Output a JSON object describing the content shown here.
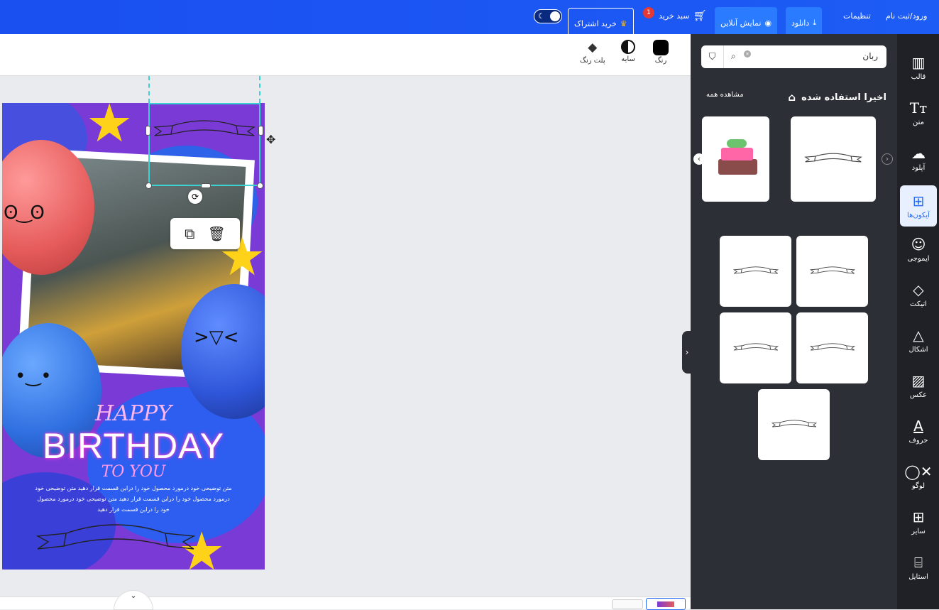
{
  "header": {
    "login": "ورود/ثبت نام",
    "settings": "تنظیمات",
    "download": "دانلود",
    "online_view": "نمایش آنلاین",
    "cart": "سبد خرید",
    "cart_count": "1",
    "subscribe": "خرید اشتراک"
  },
  "toolbar": {
    "color": "رنگ",
    "shadow": "سایه",
    "palette": "پلت رنگ"
  },
  "design": {
    "happy": "HAPPY",
    "birthday": "BIRTHDAY",
    "to_you": "TO YOU",
    "desc_lines": [
      "متن توضیحی خود درمورد محصول خود را دراین قسمت قرار دهید متن توضیحی خود",
      "درمورد محصول خود را دراین قسمت قرار دهید متن توضیحی خود درمورد محصول",
      "خود را دراین قسمت قرار دهید"
    ]
  },
  "panel": {
    "search_value": "ربان",
    "recent_title": "اخیرا استفاده شده",
    "view_all": "مشاهده همه"
  },
  "sidebar": {
    "items": [
      {
        "label": "قالب",
        "icon": "template-icon"
      },
      {
        "label": "متن",
        "icon": "text-icon"
      },
      {
        "label": "آپلود",
        "icon": "upload-icon"
      },
      {
        "label": "آیکون‌ها",
        "icon": "icons-icon"
      },
      {
        "label": "ایموجی",
        "icon": "emoji-icon"
      },
      {
        "label": "اتیکت",
        "icon": "tag-icon"
      },
      {
        "label": "اشکال",
        "icon": "shapes-icon"
      },
      {
        "label": "عکس",
        "icon": "photo-icon"
      },
      {
        "label": "حروف",
        "icon": "letters-icon"
      },
      {
        "label": "لوگو",
        "icon": "logo-icon"
      },
      {
        "label": "سایر",
        "icon": "more-icon"
      },
      {
        "label": "استایل",
        "icon": "style-icon"
      }
    ]
  },
  "colors": {
    "header": "#1d5cf5",
    "panel": "#2c2f36",
    "design_bg": "#7a3ad6",
    "selection": "#3cd2d2"
  }
}
